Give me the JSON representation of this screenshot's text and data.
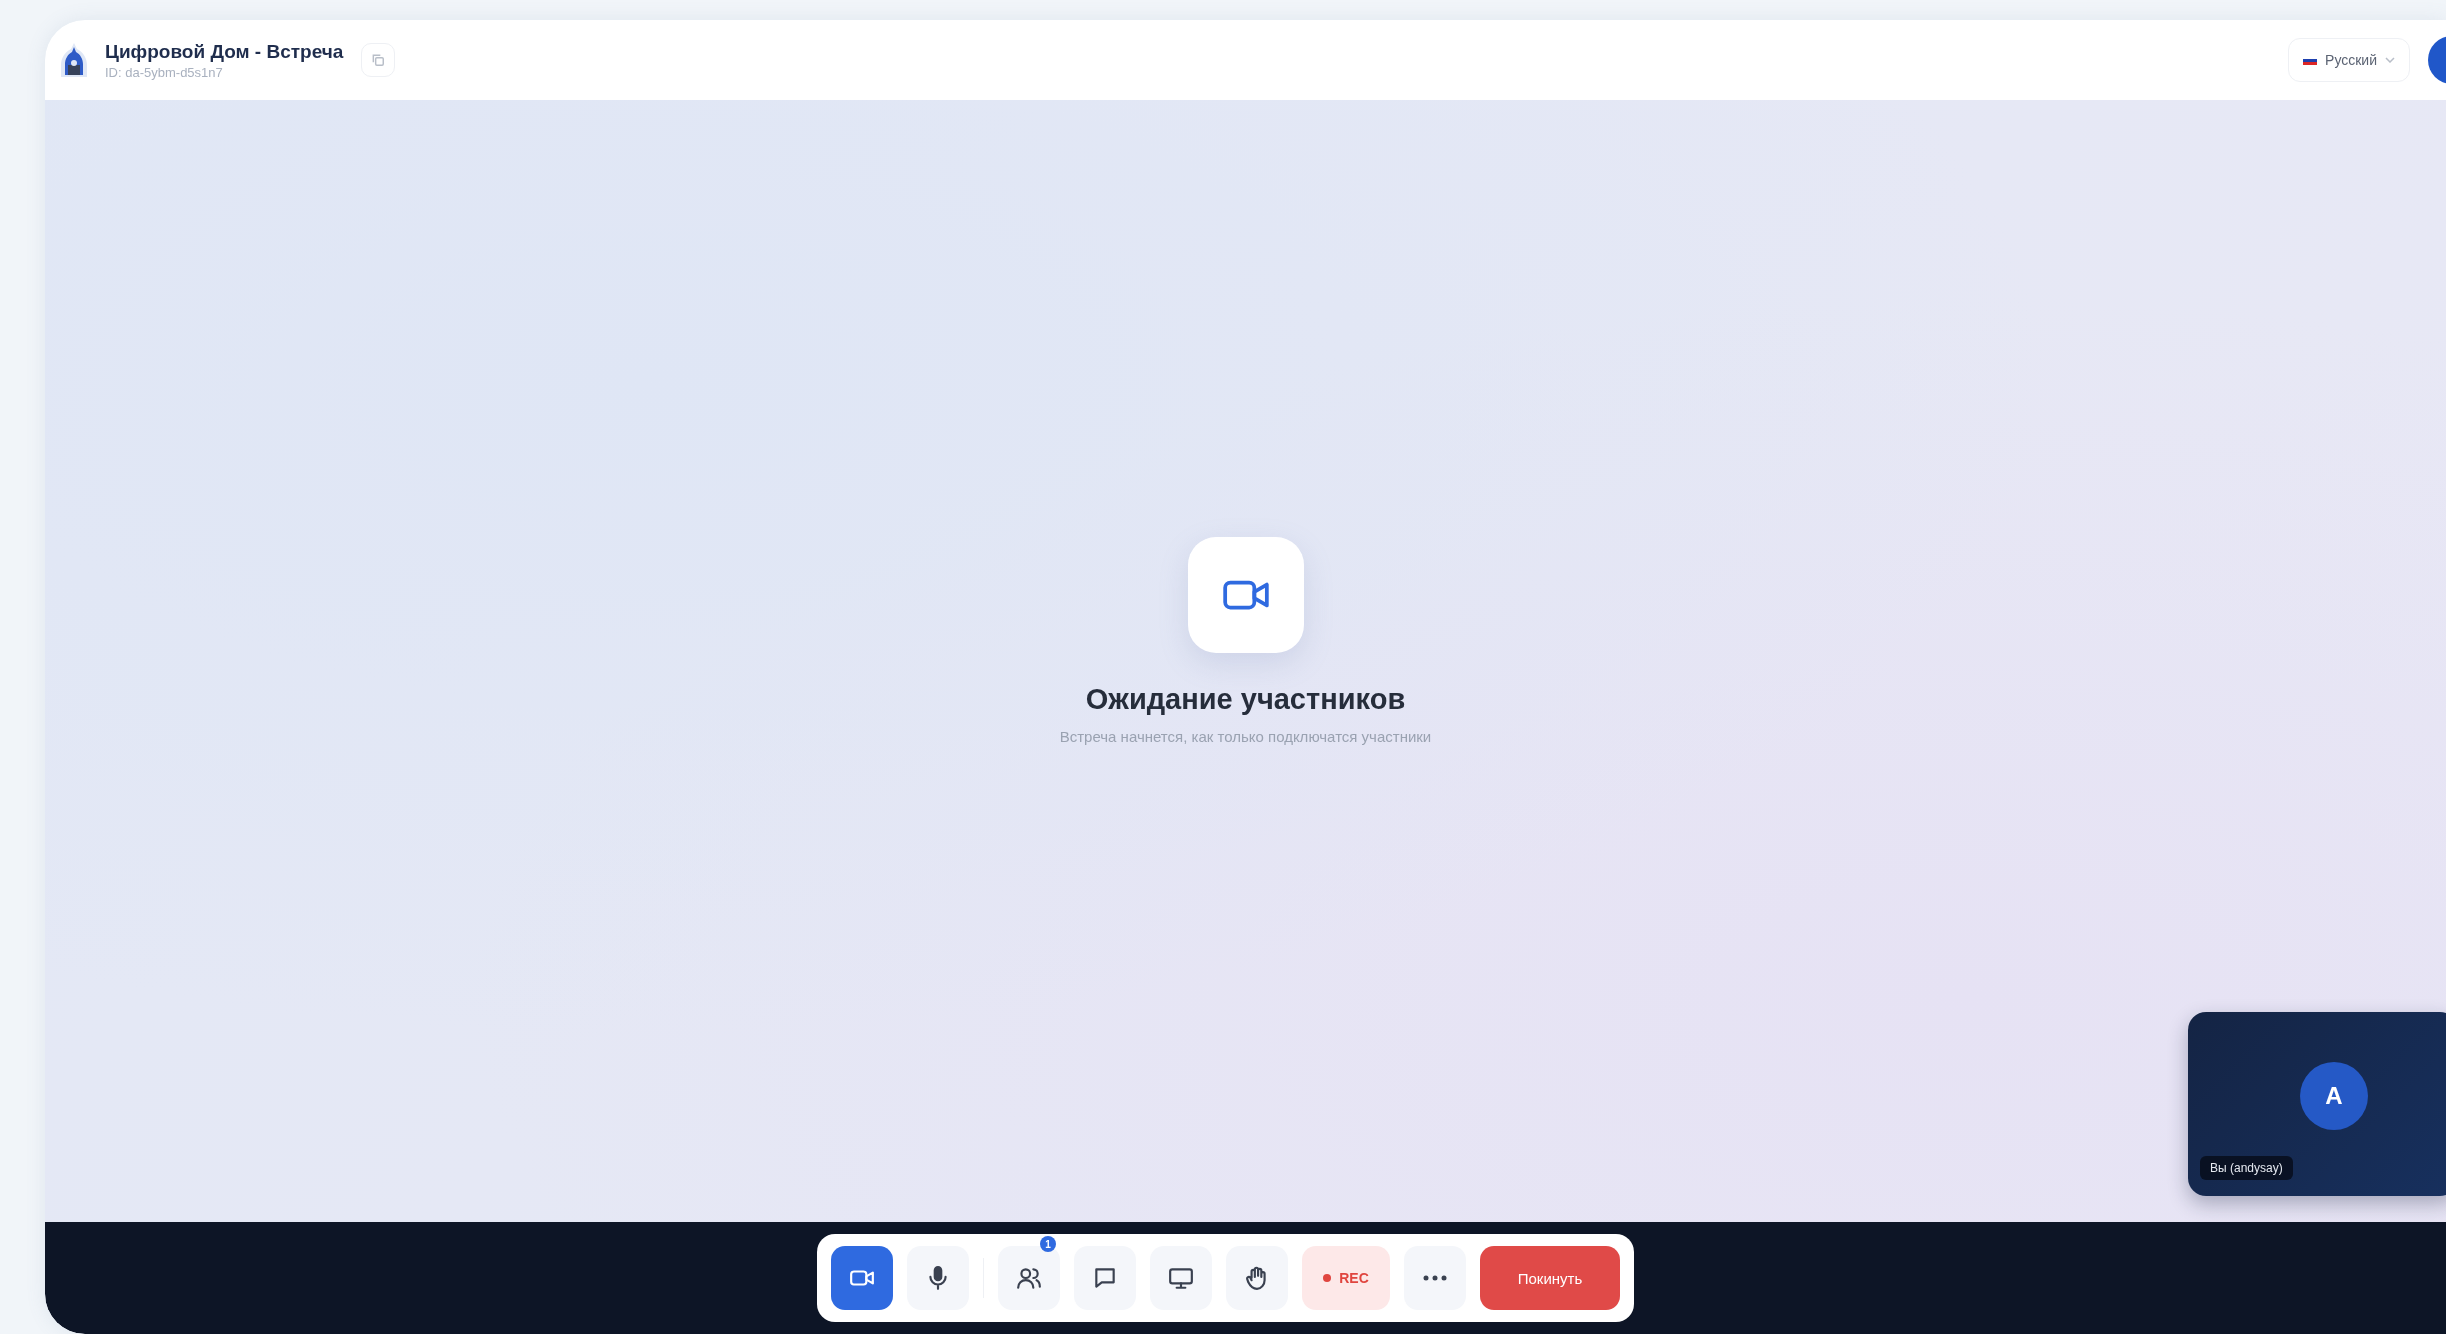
{
  "header": {
    "title": "Цифровой Дом - Встреча",
    "meeting_id": "ID: da-5ybm-d5s1n7",
    "language": "Русский"
  },
  "stage": {
    "heading": "Ожидание участников",
    "subtitle": "Встреча начнется, как только подключатся участники"
  },
  "self_view": {
    "initial": "A",
    "name": "Вы (andysay)"
  },
  "toolbar": {
    "buttons": [
      {
        "kind": "camera",
        "on": true
      },
      {
        "kind": "mic",
        "on": false
      },
      {
        "kind": "participants",
        "on": false,
        "badge": "1"
      },
      {
        "kind": "chat",
        "on": false
      },
      {
        "kind": "screen",
        "on": false
      },
      {
        "kind": "hand",
        "on": false
      },
      {
        "kind": "rec",
        "on": false,
        "label": "REC"
      },
      {
        "kind": "more",
        "on": false
      },
      {
        "kind": "leave",
        "on": false,
        "label": "Покинуть"
      }
    ]
  }
}
